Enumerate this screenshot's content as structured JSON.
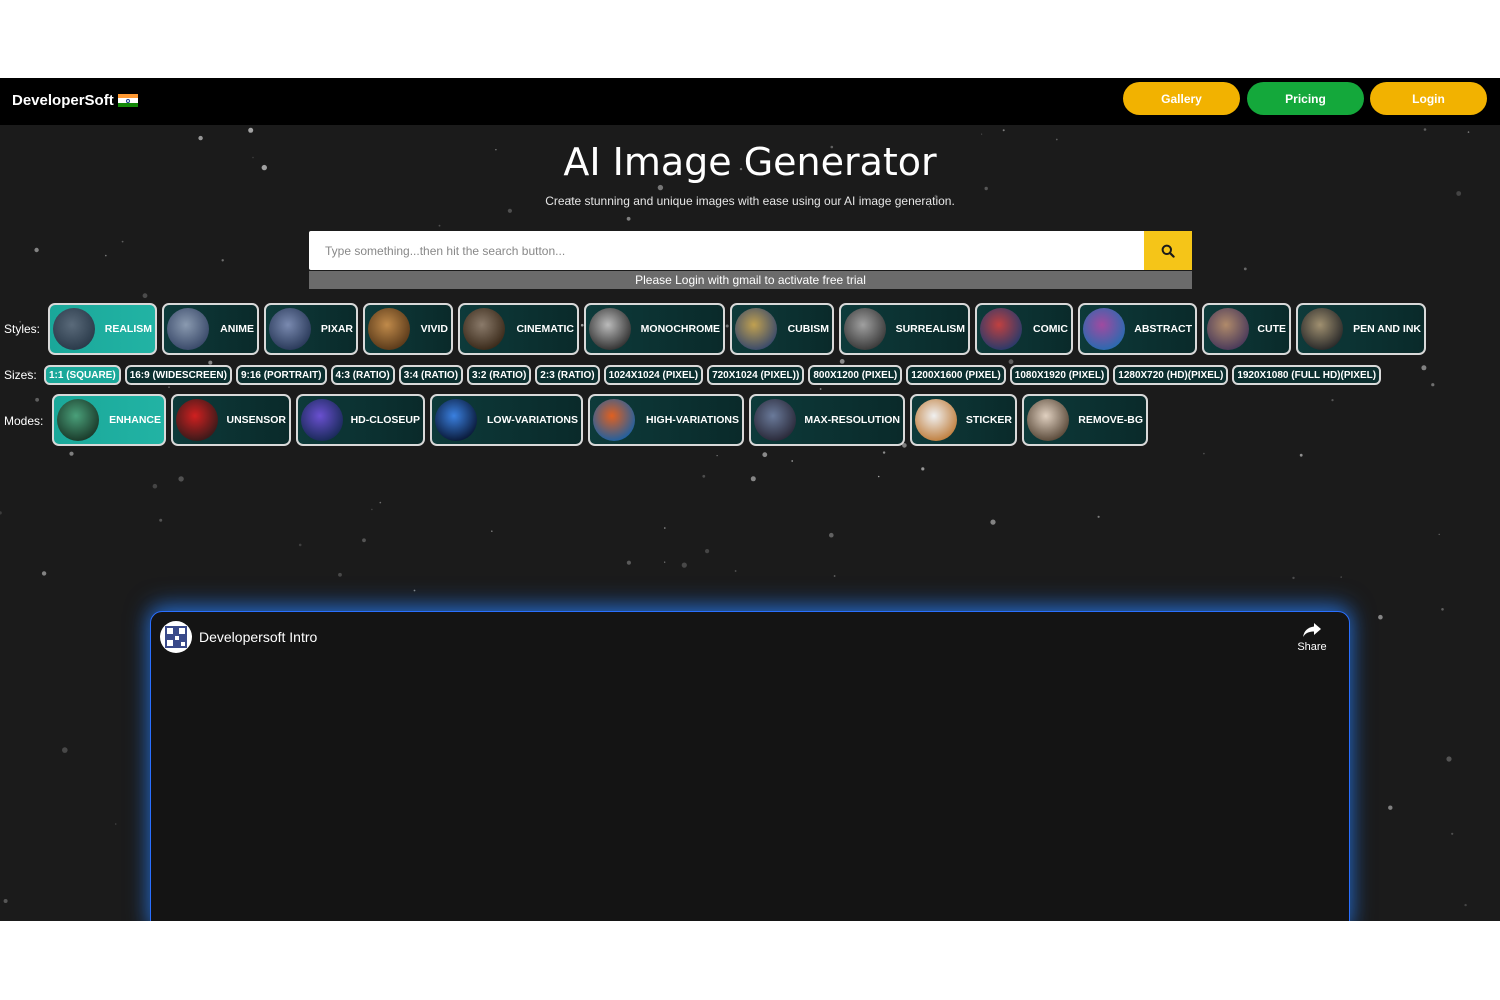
{
  "brand": {
    "name": "DeveloperSoft"
  },
  "nav": {
    "gallery": "Gallery",
    "pricing": "Pricing",
    "login": "Login"
  },
  "colors": {
    "gallery": "#f2b200",
    "pricing": "#14a83b",
    "login": "#f2b200",
    "search_button": "#f5c518",
    "active_chip": "#1aa89a"
  },
  "hero": {
    "title": "AI Image Generator",
    "subtitle": "Create stunning and unique images with ease using our AI image generation."
  },
  "search": {
    "placeholder": "Type something...then hit the search button...",
    "notice": "Please Login with gmail to activate free trial"
  },
  "styles": {
    "label": "Styles:",
    "items": [
      {
        "label": "REALISM",
        "active": true
      },
      {
        "label": "ANIME",
        "active": false
      },
      {
        "label": "PIXAR",
        "active": false
      },
      {
        "label": "VIVID",
        "active": false
      },
      {
        "label": "CINEMATIC",
        "active": false
      },
      {
        "label": "MONOCHROME",
        "active": false
      },
      {
        "label": "CUBISM",
        "active": false
      },
      {
        "label": "SURREALISM",
        "active": false
      },
      {
        "label": "COMIC",
        "active": false
      },
      {
        "label": "ABSTRACT",
        "active": false
      },
      {
        "label": "CUTE",
        "active": false
      },
      {
        "label": "PEN AND INK",
        "active": false
      }
    ]
  },
  "sizes": {
    "label": "Sizes:",
    "items": [
      {
        "label": "1:1 (SQUARE)",
        "active": true
      },
      {
        "label": "16:9 (WIDESCREEN)",
        "active": false
      },
      {
        "label": "9:16 (PORTRAIT)",
        "active": false
      },
      {
        "label": "4:3 (RATIO)",
        "active": false
      },
      {
        "label": "3:4 (RATIO)",
        "active": false
      },
      {
        "label": "3:2 (RATIO)",
        "active": false
      },
      {
        "label": "2:3 (RATIO)",
        "active": false
      },
      {
        "label": "1024X1024 (PIXEL)",
        "active": false
      },
      {
        "label": "720X1024 (PIXEL))",
        "active": false
      },
      {
        "label": "800X1200 (PIXEL)",
        "active": false
      },
      {
        "label": "1200X1600 (PIXEL)",
        "active": false
      },
      {
        "label": "1080X1920 (PIXEL)",
        "active": false
      },
      {
        "label": "1280X720 (HD)(PIXEL)",
        "active": false
      },
      {
        "label": "1920X1080 (FULL HD)(PIXEL)",
        "active": false
      }
    ]
  },
  "modes": {
    "label": "Modes:",
    "items": [
      {
        "label": "ENHANCE",
        "active": true
      },
      {
        "label": "UNSENSOR",
        "active": false
      },
      {
        "label": "HD-CLOSEUP",
        "active": false
      },
      {
        "label": "LOW-VARIATIONS",
        "active": false
      },
      {
        "label": "HIGH-VARIATIONS",
        "active": false
      },
      {
        "label": "MAX-RESOLUTION",
        "active": false
      },
      {
        "label": "STICKER",
        "active": false
      },
      {
        "label": "REMOVE-BG",
        "active": false
      }
    ]
  },
  "video": {
    "title": "Developersoft Intro",
    "share": "Share"
  }
}
